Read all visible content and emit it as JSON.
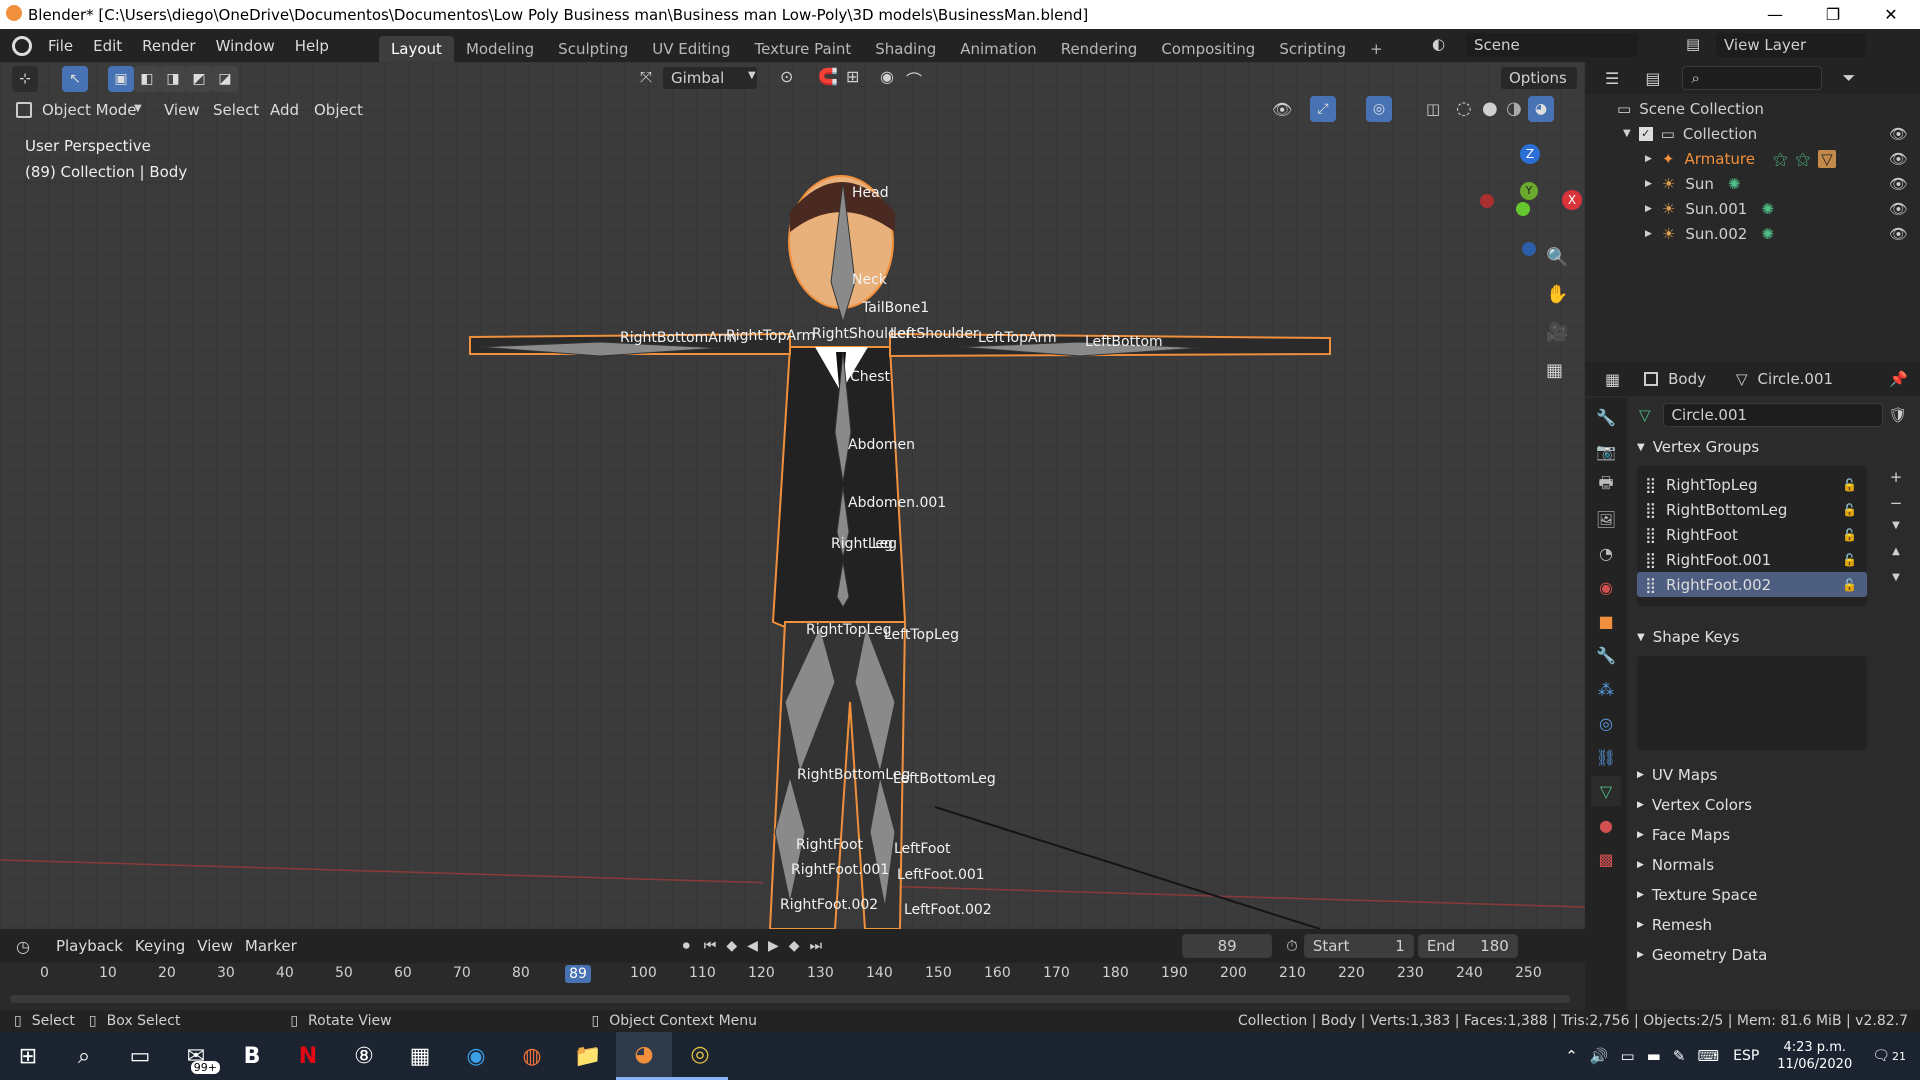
{
  "window": {
    "title": "Blender* [C:\\Users\\diego\\OneDrive\\Documentos\\Documentos\\Low Poly Business man\\Business man Low-Poly\\3D models\\BusinessMan.blend]",
    "minimize": "—",
    "maximize": "❐",
    "close": "✕"
  },
  "menu": [
    "File",
    "Edit",
    "Render",
    "Window",
    "Help"
  ],
  "workspaces": [
    "Layout",
    "Modeling",
    "Sculpting",
    "UV Editing",
    "Texture Paint",
    "Shading",
    "Animation",
    "Rendering",
    "Compositing",
    "Scripting",
    "+"
  ],
  "scene": {
    "label": "Scene",
    "view_layer": "View Layer"
  },
  "toolbar": {
    "orientation": "Gimbal",
    "options": "Options",
    "mode": "Object Mode",
    "view_menu": [
      "View",
      "Select",
      "Add",
      "Object"
    ]
  },
  "viewport": {
    "perspective": "User Perspective",
    "collection_info": "(89) Collection | Body",
    "gizmo": {
      "z": "Z",
      "y": "Y",
      "x": "X"
    },
    "bones": {
      "head": "Head",
      "neck": "Neck",
      "tailbone": "TailBone1",
      "chest": "Chest",
      "abdomen": "Abdomen",
      "abdomen001": "Abdomen.001",
      "right_leg": "RightLeg",
      "left_leg": "Leg",
      "right_top_arm": "RightTopArm",
      "right_bottom_arm": "RightBottomArm",
      "right_shoulder": "RightShoulder",
      "left_shoulder": "LeftShoulder",
      "left_top_arm": "LeftTopArm",
      "left_bottom": "LeftBottom",
      "right_top_leg": "RightTopLeg",
      "left_top_leg": "LeftTopLeg",
      "right_bottom_leg": "RightBottomLeg",
      "left_bottom_leg": "LeftBottomLeg",
      "right_foot": "RightFoot",
      "left_foot": "LeftFoot",
      "right_foot001": "RightFoot.001",
      "left_foot001": "LeftFoot.001",
      "right_foot002": "RightFoot.002",
      "left_foot002": "LeftFoot.002"
    }
  },
  "outliner": {
    "scene_collection": "Scene Collection",
    "collection": "Collection",
    "items": [
      {
        "name": "Armature",
        "color": "#f0903c"
      },
      {
        "name": "Sun",
        "color": "#d8d8d8"
      },
      {
        "name": "Sun.001",
        "color": "#d8d8d8"
      },
      {
        "name": "Sun.002",
        "color": "#d8d8d8"
      }
    ]
  },
  "properties": {
    "object": "Body",
    "mesh": "Circle.001",
    "mesh_field": "Circle.001",
    "vertex_groups_title": "Vertex Groups",
    "vertex_groups": [
      "RightTopLeg",
      "RightBottomLeg",
      "RightFoot",
      "RightFoot.001",
      "RightFoot.002"
    ],
    "shape_keys_title": "Shape Keys",
    "panels": [
      "UV Maps",
      "Vertex Colors",
      "Face Maps",
      "Normals",
      "Texture Space",
      "Remesh",
      "Geometry Data"
    ]
  },
  "timeline": {
    "menus": [
      "Playback",
      "Keying",
      "View",
      "Marker"
    ],
    "current_frame": "89",
    "start_label": "Start",
    "start": "1",
    "end_label": "End",
    "end": "180",
    "ticks": [
      "0",
      "10",
      "20",
      "30",
      "40",
      "50",
      "60",
      "70",
      "80",
      "89",
      "100",
      "110",
      "120",
      "130",
      "140",
      "150",
      "160",
      "170",
      "180",
      "190",
      "200",
      "210",
      "220",
      "230",
      "240",
      "250"
    ]
  },
  "status": {
    "select": "Select",
    "box_select": "Box Select",
    "rotate": "Rotate View",
    "context": "Object Context Menu",
    "stats": "Collection | Body | Verts:1,383 | Faces:1,388 | Tris:2,756 | Objects:2/5 | Mem: 81.6 MiB | v2.82.7"
  },
  "taskbar": {
    "mail_badge": "99+",
    "lang": "ESP",
    "time": "4:23 p.m.",
    "date": "11/06/2020",
    "notif": "21"
  },
  "colors": {
    "accent": "#4772b3",
    "orange": "#f0903c",
    "frame_highlight": "#4772b3"
  }
}
